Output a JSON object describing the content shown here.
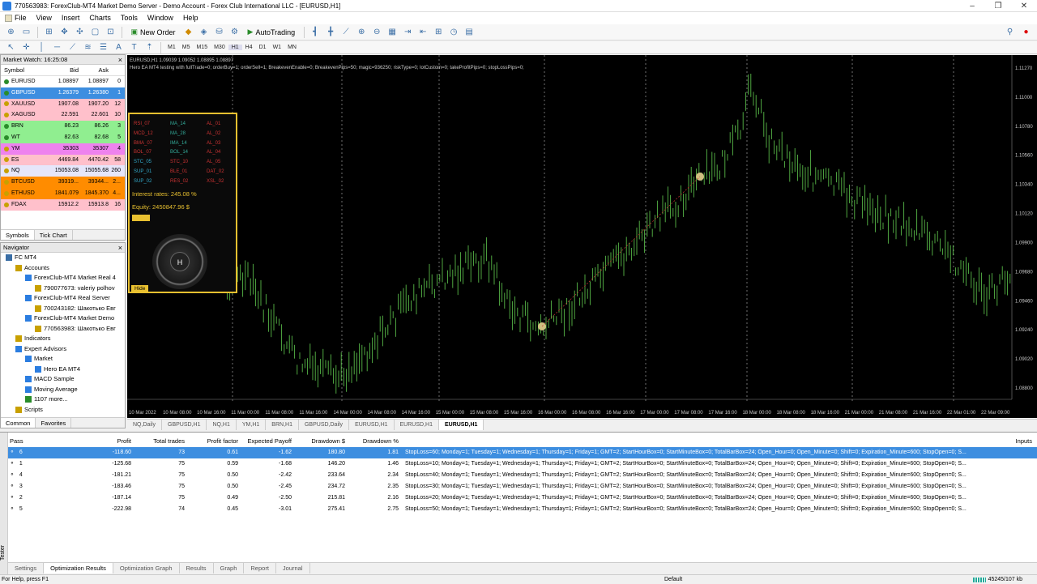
{
  "window": {
    "title": "770563983: ForexClub-MT4 Market Demo Server - Demo Account - Forex Club International LLC - [EURUSD,H1]",
    "controls": [
      "–",
      "❐",
      "✕"
    ]
  },
  "menu": [
    "File",
    "View",
    "Insert",
    "Charts",
    "Tools",
    "Window",
    "Help"
  ],
  "toolbar": {
    "new_order": "New Order",
    "autotrading": "AutoTrading",
    "timeframes": [
      "M1",
      "M5",
      "M15",
      "M30",
      "H1",
      "H4",
      "D1",
      "W1",
      "MN"
    ]
  },
  "market_watch": {
    "title": "Market Watch: 16:25:08",
    "columns": {
      "symbol": "Symbol",
      "bid": "Bid",
      "ask": "Ask",
      "spread": ""
    },
    "rows": [
      {
        "symbol": "EURUSD",
        "bid": "1.08897",
        "ask": "1.08897",
        "spread": "0",
        "bg": "#ffffff",
        "dot": "#2a8c2a"
      },
      {
        "symbol": "GBPUSD",
        "bid": "1.26379",
        "ask": "1.26380",
        "spread": "1",
        "bg": "#3d8ee0",
        "dot": "#2a8c2a",
        "sel": true
      },
      {
        "symbol": "XAUUSD",
        "bid": "1907.08",
        "ask": "1907.20",
        "spread": "12",
        "bg": "#ffc0cb",
        "dot": "#c8a000"
      },
      {
        "symbol": "XAGUSD",
        "bid": "22.591",
        "ask": "22.601",
        "spread": "10",
        "bg": "#ffc0cb",
        "dot": "#c8a000"
      },
      {
        "symbol": "BRN",
        "bid": "86.23",
        "ask": "86.26",
        "spread": "3",
        "bg": "#90ee90",
        "dot": "#2a8c2a"
      },
      {
        "symbol": "WT",
        "bid": "82.63",
        "ask": "82.68",
        "spread": "5",
        "bg": "#90ee90",
        "dot": "#2a8c2a"
      },
      {
        "symbol": "YM",
        "bid": "35303",
        "ask": "35307",
        "spread": "4",
        "bg": "#ee82ee",
        "dot": "#c8a000"
      },
      {
        "symbol": "ES",
        "bid": "4469.84",
        "ask": "4470.42",
        "spread": "58",
        "bg": "#ffc0cb",
        "dot": "#c8a000"
      },
      {
        "symbol": "NQ",
        "bid": "15053.08",
        "ask": "15055.68",
        "spread": "260",
        "bg": "#e6e6fa",
        "dot": "#c8a000"
      },
      {
        "symbol": "BTCUSD",
        "bid": "39319...",
        "ask": "39344...",
        "spread": "2...",
        "bg": "#ff8c00",
        "dot": "#c8a000"
      },
      {
        "symbol": "ETHUSD",
        "bid": "1841.079",
        "ask": "1845.370",
        "spread": "4...",
        "bg": "#ff8c00",
        "dot": "#c8a000"
      },
      {
        "symbol": "FDAX",
        "bid": "15912.2",
        "ask": "15913.8",
        "spread": "16",
        "bg": "#ffc0cb",
        "dot": "#c8a000"
      }
    ],
    "tabs": [
      "Symbols",
      "Tick Chart"
    ]
  },
  "navigator": {
    "title": "Navigator",
    "items": [
      {
        "label": "FC MT4",
        "indent": 0,
        "icon": "folder-icon",
        "color": "#3a6ea5"
      },
      {
        "label": "Accounts",
        "indent": 1,
        "icon": "accounts-icon",
        "color": "#c8a000"
      },
      {
        "label": "ForexClub-MT4 Market Real 4",
        "indent": 2,
        "icon": "server-icon",
        "color": "#2b7de0"
      },
      {
        "label": "790077673: valeriy polhov",
        "indent": 3,
        "icon": "user-icon",
        "color": "#c8a000"
      },
      {
        "label": "ForexClub-MT4 Real Server",
        "indent": 2,
        "icon": "server-icon",
        "color": "#2b7de0"
      },
      {
        "label": "700243182: Шакотько Евг",
        "indent": 3,
        "icon": "user-icon",
        "color": "#c8a000"
      },
      {
        "label": "ForexClub-MT4 Market Demo",
        "indent": 2,
        "icon": "server-icon",
        "color": "#2b7de0"
      },
      {
        "label": "770563983: Шакотько Евг",
        "indent": 3,
        "icon": "user-icon",
        "color": "#c8a000"
      },
      {
        "label": "Indicators",
        "indent": 1,
        "icon": "indicators-icon",
        "color": "#c8a000"
      },
      {
        "label": "Expert Advisors",
        "indent": 1,
        "icon": "experts-icon",
        "color": "#2b7de0"
      },
      {
        "label": "Market",
        "indent": 2,
        "icon": "market-icon",
        "color": "#2b7de0"
      },
      {
        "label": "Hero EA MT4",
        "indent": 3,
        "icon": "expert-icon",
        "color": "#2b7de0"
      },
      {
        "label": "MACD Sample",
        "indent": 2,
        "icon": "expert-icon",
        "color": "#2b7de0"
      },
      {
        "label": "Moving Average",
        "indent": 2,
        "icon": "expert-icon",
        "color": "#2b7de0"
      },
      {
        "label": "1107 more...",
        "indent": 2,
        "icon": "more-icon",
        "color": "#2a8c2a"
      },
      {
        "label": "Scripts",
        "indent": 1,
        "icon": "scripts-icon",
        "color": "#c8a000"
      }
    ],
    "tabs": [
      "Common",
      "Favorites"
    ]
  },
  "chart": {
    "symbol_line": "EURUSD,H1  1.09039 1.09052 1.08895 1.08897",
    "ea_line": "Hero EA MT4 testing with fullTrade=0; orderBuy=1; orderSell=1; BreakevenEnable=0; BreakevenPips=50; magic=936250; riskType=0; lotCustom=0; takeProfitPips=0; stopLossPips=0;",
    "price_ticks": [
      "1.11270",
      "1.11000",
      "1.10780",
      "1.10560",
      "1.10340",
      "1.10120",
      "1.09900",
      "1.09680",
      "1.09460",
      "1.09240",
      "1.09020",
      "1.08800"
    ],
    "date_ticks": [
      "10 Mar 2022",
      "10 Mar 08:00",
      "10 Mar 16:00",
      "11 Mar 00:00",
      "11 Mar 08:00",
      "11 Mar 16:00",
      "14 Mar 00:00",
      "14 Mar 08:00",
      "14 Mar 16:00",
      "15 Mar 00:00",
      "15 Mar 08:00",
      "15 Mar 16:00",
      "16 Mar 00:00",
      "16 Mar 08:00",
      "16 Mar 16:00",
      "17 Mar 00:00",
      "17 Mar 08:00",
      "17 Mar 16:00",
      "18 Mar 00:00",
      "18 Mar 08:00",
      "18 Mar 16:00",
      "21 Mar 00:00",
      "21 Mar 08:00",
      "21 Mar 16:00",
      "22 Mar 01:00",
      "22 Mar 09:00"
    ]
  },
  "hud": {
    "grid": [
      [
        "RSI_07",
        "MA_14",
        "AL_01"
      ],
      [
        "MCD_12",
        "MA_28",
        "AL_02"
      ],
      [
        "BMA_07",
        "IMA_14",
        "AL_03"
      ],
      [
        "BOL_07",
        "BOL_14",
        "AL_04"
      ],
      [
        "STC_05",
        "STC_10",
        "AL_05"
      ],
      [
        "SUP_01",
        "BLE_01",
        "DAT_02"
      ],
      [
        "SUP_02",
        "RES_02",
        "XSL_02"
      ]
    ],
    "interest": "Interest rates: 245.08 %",
    "equity": "Equity: 2450847.96 $",
    "dial": "H",
    "hide": "Hide"
  },
  "chart_tabs": [
    "NQ,Daily",
    "GBPUSD,H1",
    "NQ,H1",
    "YM,H1",
    "BRN,H1",
    "GBPUSD,Daily",
    "EURUSD,H1",
    "EURUSD,H1",
    "EURUSD,H1"
  ],
  "tester": {
    "side_label": "Tester",
    "headers": {
      "pass": "Pass",
      "profit": "Profit",
      "total": "Total trades",
      "pf": "Profit factor",
      "ep": "Expected Payoff",
      "dd": "Drawdown $",
      "ddp": "Drawdown %",
      "inputs": "Inputs"
    },
    "rows": [
      {
        "pass": "6",
        "profit": "-118.60",
        "total": "73",
        "pf": "0.61",
        "ep": "-1.62",
        "dd": "180.80",
        "ddp": "1.81",
        "inputs": "StopLoss=60; Monday=1; Tuesday=1; Wednesday=1; Thursday=1; Friday=1; GMT=2; StartHourBox=0; StartMinuteBox=0; TotalBarBox=24; Open_Hour=0; Open_Minute=0; Shift=0; Expiration_Minute=600; StopOpen=0; S..."
      },
      {
        "pass": "1",
        "profit": "-125.68",
        "total": "75",
        "pf": "0.59",
        "ep": "-1.68",
        "dd": "146.20",
        "ddp": "1.46",
        "inputs": "StopLoss=10; Monday=1; Tuesday=1; Wednesday=1; Thursday=1; Friday=1; GMT=2; StartHourBox=0; StartMinuteBox=0; TotalBarBox=24; Open_Hour=0; Open_Minute=0; Shift=0; Expiration_Minute=600; StopOpen=0; S..."
      },
      {
        "pass": "4",
        "profit": "-181.21",
        "total": "75",
        "pf": "0.50",
        "ep": "-2.42",
        "dd": "233.64",
        "ddp": "2.34",
        "inputs": "StopLoss=40; Monday=1; Tuesday=1; Wednesday=1; Thursday=1; Friday=1; GMT=2; StartHourBox=0; StartMinuteBox=0; TotalBarBox=24; Open_Hour=0; Open_Minute=0; Shift=0; Expiration_Minute=600; StopOpen=0; S..."
      },
      {
        "pass": "3",
        "profit": "-183.46",
        "total": "75",
        "pf": "0.50",
        "ep": "-2.45",
        "dd": "234.72",
        "ddp": "2.35",
        "inputs": "StopLoss=30; Monday=1; Tuesday=1; Wednesday=1; Thursday=1; Friday=1; GMT=2; StartHourBox=0; StartMinuteBox=0; TotalBarBox=24; Open_Hour=0; Open_Minute=0; Shift=0; Expiration_Minute=600; StopOpen=0; S..."
      },
      {
        "pass": "2",
        "profit": "-187.14",
        "total": "75",
        "pf": "0.49",
        "ep": "-2.50",
        "dd": "215.81",
        "ddp": "2.16",
        "inputs": "StopLoss=20; Monday=1; Tuesday=1; Wednesday=1; Thursday=1; Friday=1; GMT=2; StartHourBox=0; StartMinuteBox=0; TotalBarBox=24; Open_Hour=0; Open_Minute=0; Shift=0; Expiration_Minute=600; StopOpen=0; S..."
      },
      {
        "pass": "5",
        "profit": "-222.98",
        "total": "74",
        "pf": "0.45",
        "ep": "-3.01",
        "dd": "275.41",
        "ddp": "2.75",
        "inputs": "StopLoss=50; Monday=1; Tuesday=1; Wednesday=1; Thursday=1; Friday=1; GMT=2; StartHourBox=0; StartMinuteBox=0; TotalBarBox=24; Open_Hour=0; Open_Minute=0; Shift=0; Expiration_Minute=600; StopOpen=0; S..."
      }
    ],
    "tabs": [
      "Settings",
      "Optimization Results",
      "Optimization Graph",
      "Results",
      "Graph",
      "Report",
      "Journal"
    ]
  },
  "status": {
    "help": "For Help, press F1",
    "profile": "Default",
    "traffic": "45245/107 kb"
  }
}
